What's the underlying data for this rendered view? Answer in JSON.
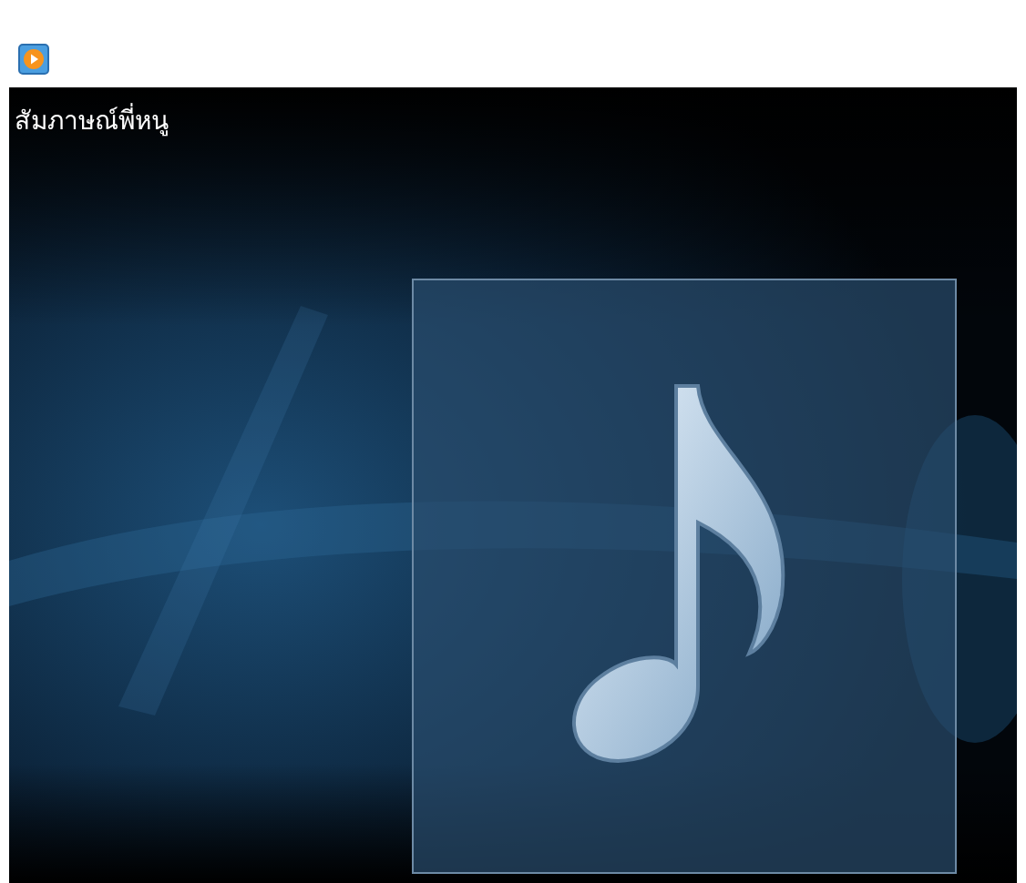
{
  "player": {
    "title": "สัมภาษณ์พี่หนู"
  }
}
